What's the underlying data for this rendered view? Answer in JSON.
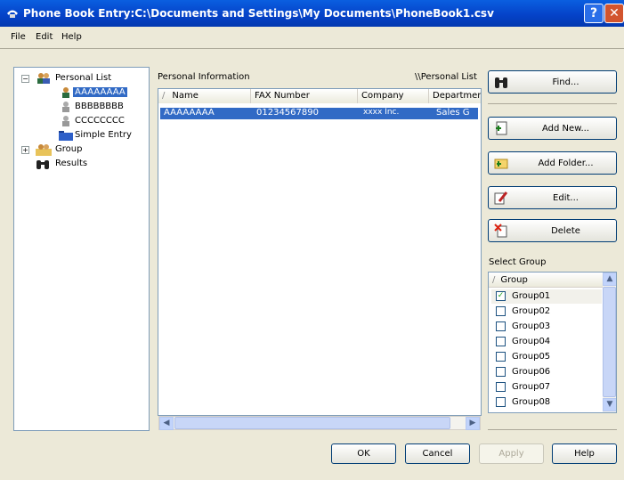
{
  "window": {
    "title": "Phone Book Entry:C:\\Documents and Settings\\My Documents\\PhoneBook1.csv",
    "help_glyph": "?",
    "close_glyph": "✕"
  },
  "menu": {
    "items": [
      "File",
      "Edit",
      "Help"
    ]
  },
  "tree": {
    "personal_list": "Personal List",
    "entries": [
      "AAAAAAAA",
      "BBBBBBBB",
      "CCCCCCCC"
    ],
    "simple_entry": "Simple Entry",
    "group": "Group",
    "results": "Results",
    "expand_glyph": "+",
    "collapse_glyph": "−"
  },
  "info": {
    "label": "Personal Information",
    "path": "\\\\Personal List",
    "columns": [
      "Name",
      "FAX Number",
      "Company",
      "Departmer"
    ],
    "sort_glyph": "/",
    "rows": [
      {
        "name": "AAAAAAAA",
        "fax": "01234567890",
        "company": "xxxx Inc.",
        "department": "Sales G"
      }
    ]
  },
  "buttons": {
    "find": "Find...",
    "add_new": "Add New...",
    "add_folder": "Add Folder...",
    "edit": "Edit...",
    "delete": "Delete",
    "ok": "OK",
    "cancel": "Cancel",
    "apply": "Apply",
    "help": "Help"
  },
  "select_group": {
    "label": "Select Group",
    "header": "Group",
    "sort_glyph": "/",
    "items": [
      {
        "name": "Group01",
        "checked": true
      },
      {
        "name": "Group02",
        "checked": false
      },
      {
        "name": "Group03",
        "checked": false
      },
      {
        "name": "Group04",
        "checked": false
      },
      {
        "name": "Group05",
        "checked": false
      },
      {
        "name": "Group06",
        "checked": false
      },
      {
        "name": "Group07",
        "checked": false
      },
      {
        "name": "Group08",
        "checked": false
      }
    ]
  },
  "scroll": {
    "left": "◀",
    "right": "▶",
    "up": "▲",
    "down": "▼"
  },
  "colors": {
    "titlebar": "#0543c9",
    "selection": "#316ac5",
    "face": "#ece9d8"
  }
}
